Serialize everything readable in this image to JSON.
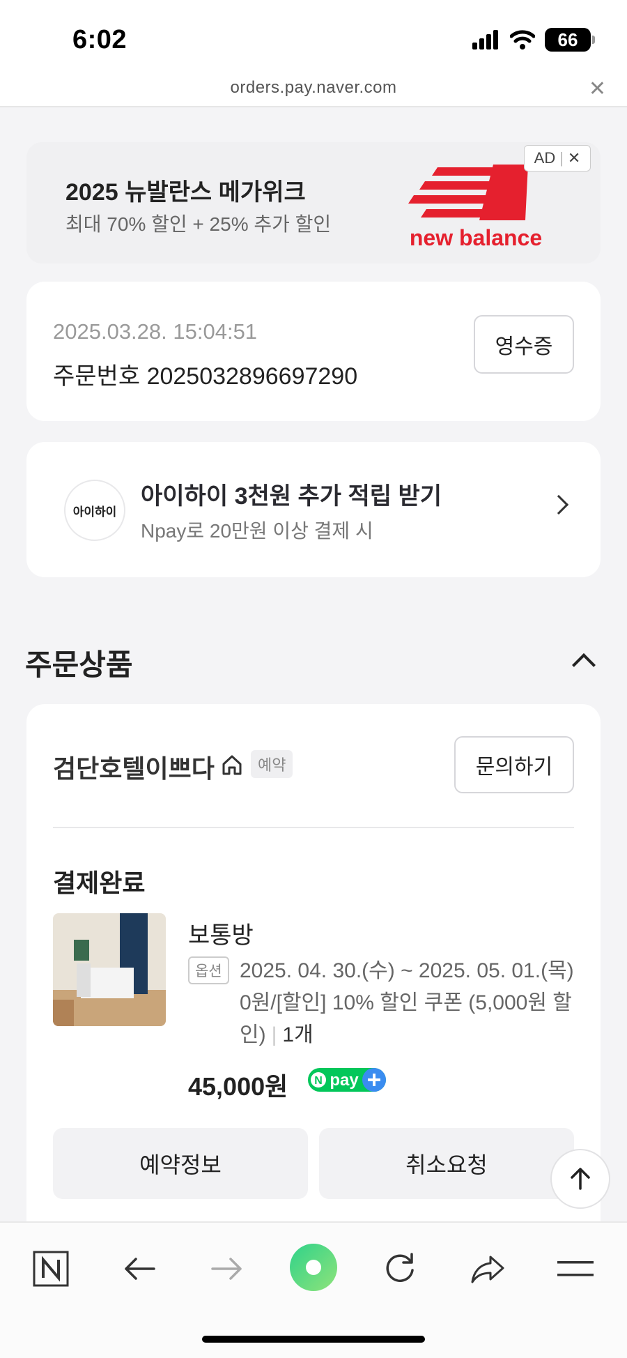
{
  "status_bar": {
    "time": "6:02",
    "battery": "66"
  },
  "browser": {
    "url": "orders.pay.naver.com"
  },
  "ad": {
    "title": "2025 뉴발란스 메가위크",
    "subtitle": "최대 70% 할인 + 25% 추가 할인",
    "brand": "new balance",
    "badge": "AD",
    "brand_color": "#e5202e"
  },
  "order": {
    "date": "2025.03.28. 15:04:51",
    "number": "주문번호 2025032896697290",
    "receipt_label": "영수증"
  },
  "promo": {
    "logo_text": "아이하이",
    "title": "아이하이 3천원 추가 적립 받기",
    "subtitle": "Npay로 20만원 이상 결제 시"
  },
  "section": {
    "title": "주문상품"
  },
  "product": {
    "store": "검단호텔이쁘다",
    "tag": "예약",
    "inquiry_label": "문의하기",
    "status": "결제완료",
    "room": "보통방",
    "option_tag": "옵션",
    "option_text": "2025. 04. 30.(수) ~ 2025. 05. 01.(목) 0원/[할인] 10% 할인 쿠폰 (5,000원 할인)",
    "quantity": "1개",
    "price": "45,000원",
    "npay_label": "pay",
    "actions": [
      "예약정보",
      "취소요청"
    ]
  },
  "toolbar": {
    "icons": [
      "naver-icon",
      "back-icon",
      "forward-icon",
      "green-dot-icon",
      "refresh-icon",
      "share-icon",
      "menu-icon"
    ]
  }
}
